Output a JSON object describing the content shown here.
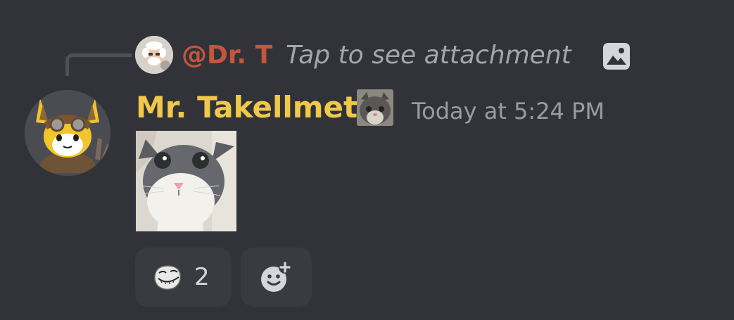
{
  "reply": {
    "author": "@Dr. T",
    "text": "Tap to see attachment",
    "icon": "image-icon"
  },
  "message": {
    "username": "Mr. Takellmet",
    "timestamp": "Today at 5:24 PM",
    "attachment": "cat-photo",
    "username_color": "#f0c84a",
    "reply_author_color": "#c5553d"
  },
  "reactions": [
    {
      "emoji": "trollface-emoji",
      "count": "2"
    }
  ],
  "add_reaction": {
    "icon": "add-reaction-icon"
  }
}
